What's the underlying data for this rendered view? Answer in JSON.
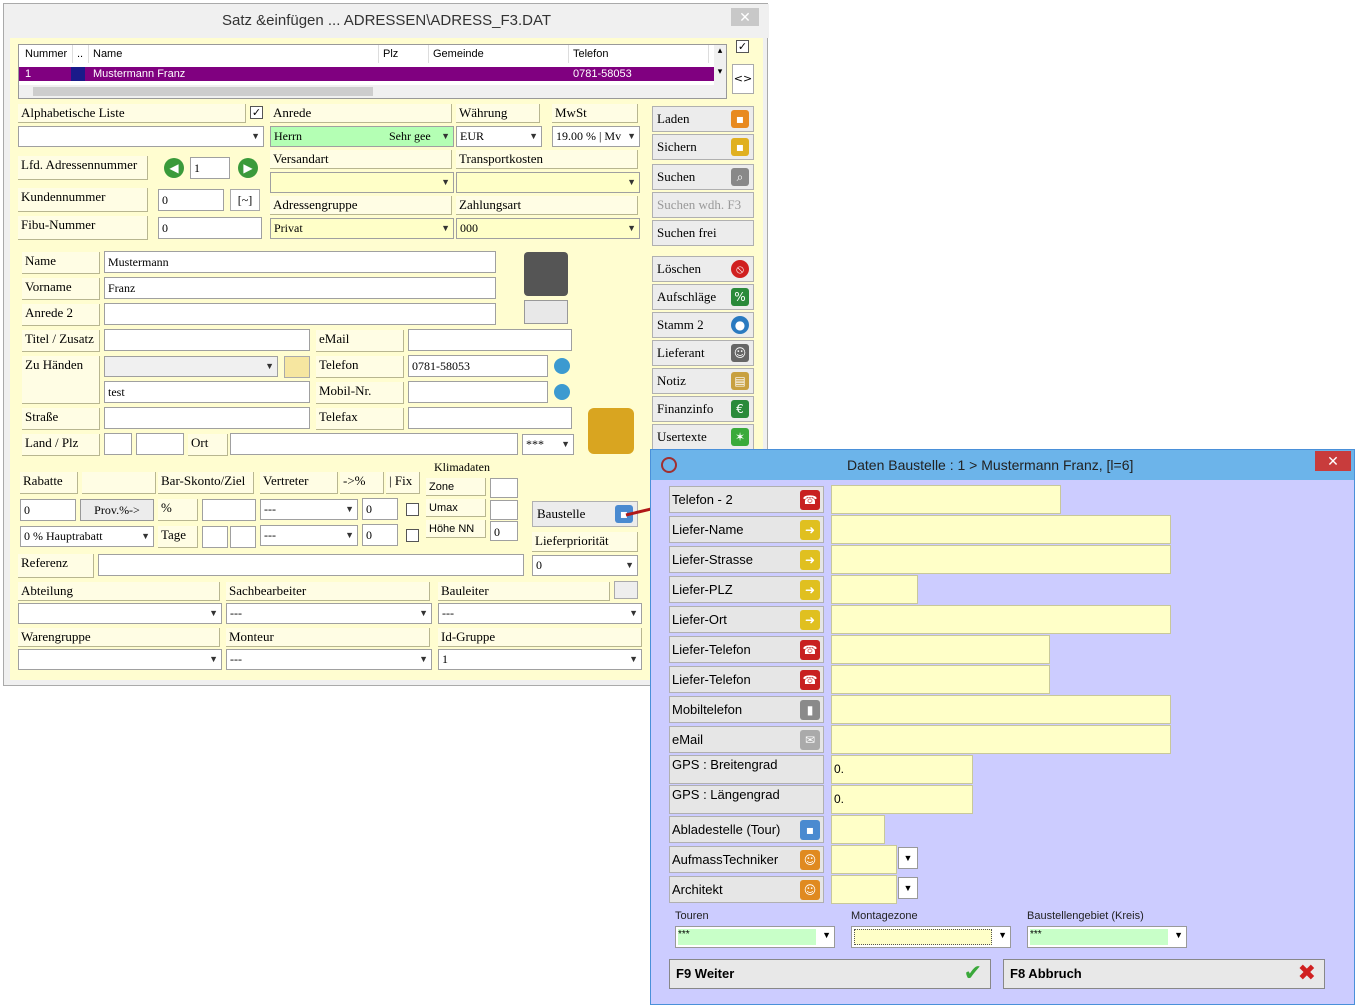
{
  "main_window": {
    "title": "Satz &einfügen ... ADRESSEN\\ADRESS_F3.DAT",
    "close": "✕",
    "grid": {
      "headers": [
        "Nummer",
        "..",
        "Name",
        "Plz",
        "Gemeinde",
        "Telefon"
      ],
      "row": {
        "nummer": "1",
        "name": "Mustermann Franz",
        "plz": "",
        "gemeinde": "",
        "telefon": "0781-58053"
      }
    },
    "labels": {
      "alpha_list": "Alphabetische Liste",
      "anrede": "Anrede",
      "waehrung": "Währung",
      "mwst": "MwSt",
      "lfd": "Lfd. Adressennummer",
      "versandart": "Versandart",
      "transportkosten": "Transportkosten",
      "kundennummer": "Kundennummer",
      "adressengruppe": "Adressengruppe",
      "zahlungsart": "Zahlungsart",
      "fibu": "Fibu-Nummer",
      "name": "Name",
      "vorname": "Vorname",
      "anrede2": "Anrede 2",
      "titel": "Titel / Zusatz",
      "email": "eMail",
      "zu_haenden": "Zu Händen",
      "telefon": "Telefon",
      "mobil": "Mobil-Nr.",
      "strasse": "Straße",
      "telefax": "Telefax",
      "land": "Land / Plz",
      "ort": "Ort",
      "rabatte": "Rabatte",
      "skonto": "Bar-Skonto/Ziel",
      "vertreter": "Vertreter",
      "pct": "->%",
      "fix": "| Fix",
      "klima": "Klimadaten",
      "zone": "Zone",
      "umax": "Umax",
      "hoehe": "Höhe NN",
      "prozent": "%",
      "tage": "Tage",
      "referenz": "Referenz",
      "lieferprio": "Lieferpriorität",
      "abteilung": "Abteilung",
      "sachbearbeiter": "Sachbearbeiter",
      "bauleiter": "Bauleiter",
      "warengruppe": "Warengruppe",
      "monteur": "Monteur",
      "idgruppe": "Id-Gruppe"
    },
    "values": {
      "anrede": "Herrn",
      "anrede_hint": "Sehr gee",
      "waehrung": "EUR",
      "mwst": "19.00 % | Mv",
      "lfd": "1",
      "kundennummer": "0",
      "kunden_btn": "[~]",
      "adressengruppe": "Privat",
      "zahlungsart": "000",
      "fibu": "0",
      "name": "Mustermann",
      "vorname": "Franz",
      "telefon": "0781-58053",
      "zu_haenden2": "test",
      "land_sel": "***",
      "rabatt": "0",
      "prov_btn": "Prov.%->",
      "haupt": "0 % Hauptrabatt",
      "vert1": "---",
      "vert2": "---",
      "pct1": "0",
      "pct2": "0",
      "hoehe": "0",
      "lieferprio": "0",
      "sachbearbeiter": "---",
      "bauleiter": "---",
      "monteur": "---",
      "idgruppe": "1",
      "baustelle_btn": "Baustelle"
    },
    "buttons": [
      "Laden",
      "Sichern",
      "Suchen",
      "Suchen wdh. F3",
      "Suchen frei",
      "Löschen",
      "Aufschläge",
      "Stamm 2",
      "Lieferant",
      "Notiz",
      "Finanzinfo",
      "Usertexte"
    ]
  },
  "dialog": {
    "title": "Daten Baustelle : 1 > Mustermann Franz,   [l=6]",
    "close": "✕",
    "rows": [
      {
        "label": "Telefon - 2",
        "value": ""
      },
      {
        "label": "Liefer-Name",
        "value": ""
      },
      {
        "label": "Liefer-Strasse",
        "value": ""
      },
      {
        "label": "Liefer-PLZ",
        "value": ""
      },
      {
        "label": "Liefer-Ort",
        "value": ""
      },
      {
        "label": "Liefer-Telefon",
        "value": ""
      },
      {
        "label": "Liefer-Telefon",
        "value": ""
      },
      {
        "label": "Mobiltelefon",
        "value": ""
      },
      {
        "label": "eMail",
        "value": ""
      },
      {
        "label": "GPS : Breitengrad",
        "value": "0."
      },
      {
        "label": "GPS : Längengrad",
        "value": "0."
      },
      {
        "label": "Abladestelle (Tour)",
        "value": ""
      },
      {
        "label": "AufmassTechniker",
        "value": ""
      },
      {
        "label": "Architekt",
        "value": ""
      }
    ],
    "touren": "Touren",
    "montagezone": "Montagezone",
    "baustellengebiet": "Baustellengebiet (Kreis)",
    "touren_val": "***",
    "gebiet_val": "***",
    "weiter": "F9 Weiter",
    "abbruch": "F8 Abbruch"
  },
  "colors": {
    "accent": "#800080",
    "dialog_bg": "#ccccff",
    "field_yellow": "#ffffc8",
    "title_blue": "#6cb4ea"
  }
}
